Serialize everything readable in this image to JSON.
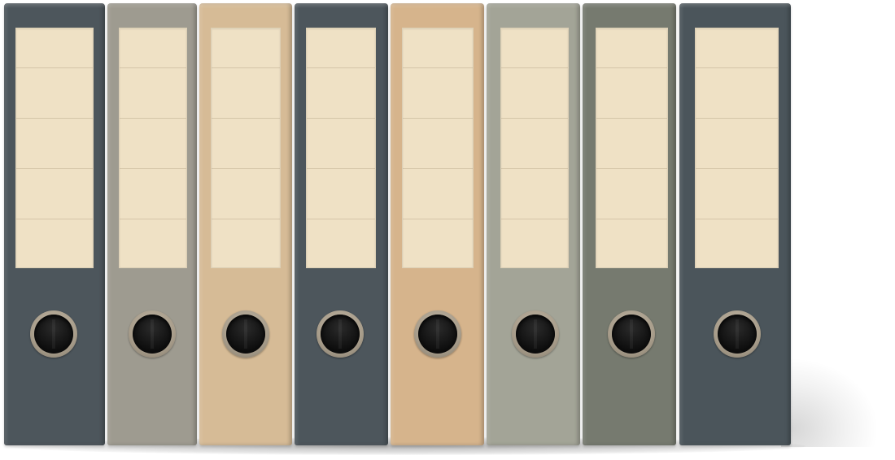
{
  "scene": {
    "background": "#ffffff",
    "label_color": "#efe1c5",
    "ring_rim_color": "#a89d8b",
    "binders": [
      {
        "color": "#4d565c"
      },
      {
        "color": "#9e9b90"
      },
      {
        "color": "#d6bb96"
      },
      {
        "color": "#4d565c"
      },
      {
        "color": "#d6b48c"
      },
      {
        "color": "#a3a497"
      },
      {
        "color": "#767a6f"
      },
      {
        "color": "#4b555b"
      }
    ]
  }
}
